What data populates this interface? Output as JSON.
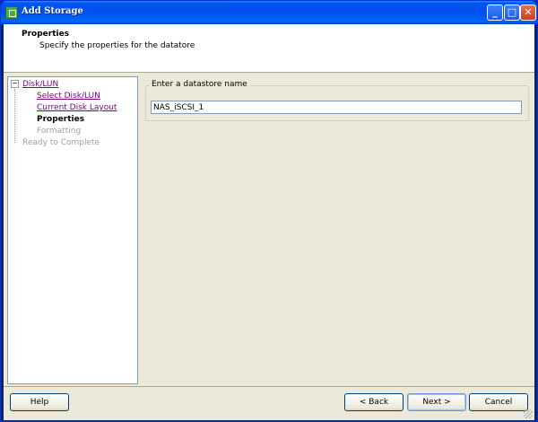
{
  "window": {
    "title": "Add Storage",
    "controls": {
      "minimize": "_",
      "maximize": "□",
      "close": "✕"
    }
  },
  "header": {
    "title": "Properties",
    "subtitle": "Specify the properties for the datatore"
  },
  "nav": {
    "toggle": "−",
    "items": [
      {
        "label": "Disk/LUN",
        "state": "link"
      },
      {
        "label": "Select Disk/LUN",
        "state": "link"
      },
      {
        "label": "Current Disk Layout",
        "state": "link"
      },
      {
        "label": "Properties",
        "state": "current"
      },
      {
        "label": "Formatting",
        "state": "disabled"
      },
      {
        "label": "Ready to Complete",
        "state": "disabled"
      }
    ]
  },
  "main": {
    "group_label": "Enter a datastore name",
    "datastore_name": "NAS_iSCSI_1"
  },
  "footer": {
    "help": "Help",
    "back": "< Back",
    "next": "Next >",
    "cancel": "Cancel"
  },
  "colors": {
    "titlebar": "#0050ee",
    "link": "#800080",
    "disabled": "#a0a0a0",
    "panel": "#ece9d8"
  }
}
